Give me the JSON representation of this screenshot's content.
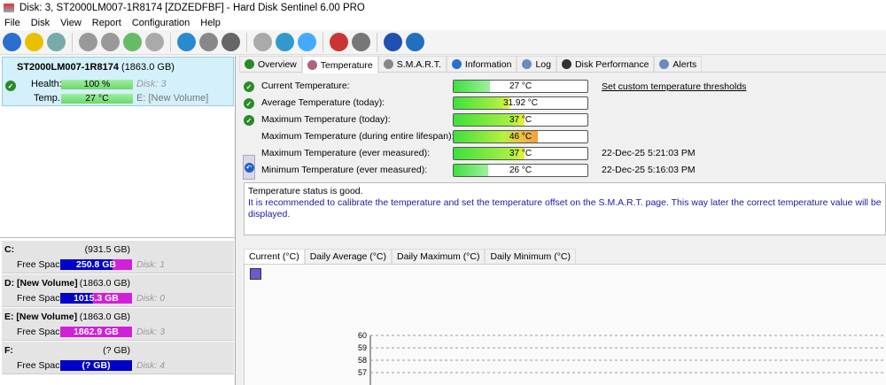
{
  "window": {
    "title": "Disk: 3, ST2000LM007-1R8174 [ZDZEDFBF]  -  Hard Disk Sentinel 6.00 PRO"
  },
  "menu": [
    "File",
    "Disk",
    "View",
    "Report",
    "Configuration",
    "Help"
  ],
  "toolbar": [
    "refresh-icon",
    "alert-icon",
    "disk-icon",
    "disk-tool-1-icon",
    "disk-tool-2-icon",
    "disk-check-icon",
    "disk-search-icon",
    "globe-icon",
    "drive-icon",
    "drive-2-icon",
    "report-icon",
    "sync-icon",
    "network-icon",
    "chart-icon",
    "speaker-icon",
    "help-icon",
    "info-icon"
  ],
  "disk": {
    "name": "ST2000LM007-1R8174",
    "size": "(1863.0 GB)",
    "health_label": "Health:",
    "health": "100 %",
    "health_pct": 100,
    "disk_no": "Disk: 3",
    "temp_label": "Temp.:",
    "temp": "27 °C",
    "volume": "E: [New Volume]"
  },
  "volumes": [
    {
      "name": "C:",
      "size": "(931.5 GB)",
      "free_label": "Free Space",
      "free": "250.8 GB",
      "free_pct": 27,
      "disk": "Disk: 1"
    },
    {
      "name": "D: [New Volume]",
      "size": "(1863.0 GB)",
      "free_label": "Free Space",
      "free": "1015.3 GB",
      "free_pct": 55,
      "disk": "Disk: 0"
    },
    {
      "name": "E: [New Volume]",
      "size": "(1863.0 GB)",
      "free_label": "Free Space",
      "free": "1862.9 GB",
      "free_pct": 100,
      "disk": "Disk: 3"
    },
    {
      "name": "F:",
      "size": "(? GB)",
      "free_label": "Free Space",
      "free": "(? GB)",
      "free_pct": 0,
      "disk": "Disk: 4"
    }
  ],
  "tabs": [
    "Overview",
    "Temperature",
    "S.M.A.R.T.",
    "Information",
    "Log",
    "Disk Performance",
    "Alerts"
  ],
  "temps": [
    {
      "label": "Current Temperature:",
      "value": "27 °C",
      "pct": 27,
      "check": true,
      "date": ""
    },
    {
      "label": "Average Temperature (today):",
      "value": "31.92 °C",
      "pct": 42,
      "check": true,
      "date": ""
    },
    {
      "label": "Maximum Temperature (today):",
      "value": "37 °C",
      "pct": 53,
      "check": true,
      "date": ""
    },
    {
      "label": "Maximum Temperature (during entire lifespan):",
      "value": "46 °C",
      "pct": 63,
      "check": false,
      "date": ""
    },
    {
      "label": "Maximum Temperature (ever measured):",
      "value": "37 °C",
      "pct": 53,
      "check": false,
      "date": "22-Dec-25 5:21:03 PM"
    },
    {
      "label": "Minimum Temperature (ever measured):",
      "value": "26 °C",
      "pct": 26,
      "check": false,
      "date": "22-Dec-25 5:16:03 PM"
    }
  ],
  "threshold_link": "Set custom temperature thresholds",
  "status": {
    "line1": "Temperature status is good.",
    "line2": "It is recommended to calibrate the temperature and set the temperature offset on the S.M.A.R.T. page. This way later the correct temperature value will be displayed."
  },
  "chart_tabs": [
    "Current (°C)",
    "Daily Average (°C)",
    "Daily Maximum (°C)",
    "Daily Minimum (°C)"
  ],
  "chart_data": {
    "type": "line",
    "y_ticks": [
      "60",
      "59",
      "58",
      "57"
    ],
    "ylim": [
      56,
      60
    ],
    "series": []
  }
}
